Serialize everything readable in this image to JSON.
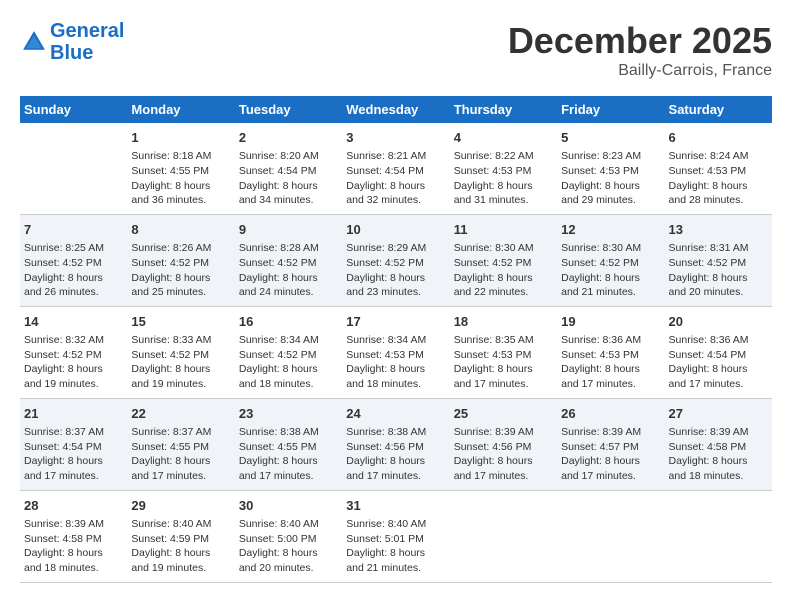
{
  "header": {
    "logo_line1": "General",
    "logo_line2": "Blue",
    "month": "December 2025",
    "location": "Bailly-Carrois, France"
  },
  "weekdays": [
    "Sunday",
    "Monday",
    "Tuesday",
    "Wednesday",
    "Thursday",
    "Friday",
    "Saturday"
  ],
  "weeks": [
    [
      {
        "day": "",
        "info": ""
      },
      {
        "day": "1",
        "info": "Sunrise: 8:18 AM\nSunset: 4:55 PM\nDaylight: 8 hours\nand 36 minutes."
      },
      {
        "day": "2",
        "info": "Sunrise: 8:20 AM\nSunset: 4:54 PM\nDaylight: 8 hours\nand 34 minutes."
      },
      {
        "day": "3",
        "info": "Sunrise: 8:21 AM\nSunset: 4:54 PM\nDaylight: 8 hours\nand 32 minutes."
      },
      {
        "day": "4",
        "info": "Sunrise: 8:22 AM\nSunset: 4:53 PM\nDaylight: 8 hours\nand 31 minutes."
      },
      {
        "day": "5",
        "info": "Sunrise: 8:23 AM\nSunset: 4:53 PM\nDaylight: 8 hours\nand 29 minutes."
      },
      {
        "day": "6",
        "info": "Sunrise: 8:24 AM\nSunset: 4:53 PM\nDaylight: 8 hours\nand 28 minutes."
      }
    ],
    [
      {
        "day": "7",
        "info": "Sunrise: 8:25 AM\nSunset: 4:52 PM\nDaylight: 8 hours\nand 26 minutes."
      },
      {
        "day": "8",
        "info": "Sunrise: 8:26 AM\nSunset: 4:52 PM\nDaylight: 8 hours\nand 25 minutes."
      },
      {
        "day": "9",
        "info": "Sunrise: 8:28 AM\nSunset: 4:52 PM\nDaylight: 8 hours\nand 24 minutes."
      },
      {
        "day": "10",
        "info": "Sunrise: 8:29 AM\nSunset: 4:52 PM\nDaylight: 8 hours\nand 23 minutes."
      },
      {
        "day": "11",
        "info": "Sunrise: 8:30 AM\nSunset: 4:52 PM\nDaylight: 8 hours\nand 22 minutes."
      },
      {
        "day": "12",
        "info": "Sunrise: 8:30 AM\nSunset: 4:52 PM\nDaylight: 8 hours\nand 21 minutes."
      },
      {
        "day": "13",
        "info": "Sunrise: 8:31 AM\nSunset: 4:52 PM\nDaylight: 8 hours\nand 20 minutes."
      }
    ],
    [
      {
        "day": "14",
        "info": "Sunrise: 8:32 AM\nSunset: 4:52 PM\nDaylight: 8 hours\nand 19 minutes."
      },
      {
        "day": "15",
        "info": "Sunrise: 8:33 AM\nSunset: 4:52 PM\nDaylight: 8 hours\nand 19 minutes."
      },
      {
        "day": "16",
        "info": "Sunrise: 8:34 AM\nSunset: 4:52 PM\nDaylight: 8 hours\nand 18 minutes."
      },
      {
        "day": "17",
        "info": "Sunrise: 8:34 AM\nSunset: 4:53 PM\nDaylight: 8 hours\nand 18 minutes."
      },
      {
        "day": "18",
        "info": "Sunrise: 8:35 AM\nSunset: 4:53 PM\nDaylight: 8 hours\nand 17 minutes."
      },
      {
        "day": "19",
        "info": "Sunrise: 8:36 AM\nSunset: 4:53 PM\nDaylight: 8 hours\nand 17 minutes."
      },
      {
        "day": "20",
        "info": "Sunrise: 8:36 AM\nSunset: 4:54 PM\nDaylight: 8 hours\nand 17 minutes."
      }
    ],
    [
      {
        "day": "21",
        "info": "Sunrise: 8:37 AM\nSunset: 4:54 PM\nDaylight: 8 hours\nand 17 minutes."
      },
      {
        "day": "22",
        "info": "Sunrise: 8:37 AM\nSunset: 4:55 PM\nDaylight: 8 hours\nand 17 minutes."
      },
      {
        "day": "23",
        "info": "Sunrise: 8:38 AM\nSunset: 4:55 PM\nDaylight: 8 hours\nand 17 minutes."
      },
      {
        "day": "24",
        "info": "Sunrise: 8:38 AM\nSunset: 4:56 PM\nDaylight: 8 hours\nand 17 minutes."
      },
      {
        "day": "25",
        "info": "Sunrise: 8:39 AM\nSunset: 4:56 PM\nDaylight: 8 hours\nand 17 minutes."
      },
      {
        "day": "26",
        "info": "Sunrise: 8:39 AM\nSunset: 4:57 PM\nDaylight: 8 hours\nand 17 minutes."
      },
      {
        "day": "27",
        "info": "Sunrise: 8:39 AM\nSunset: 4:58 PM\nDaylight: 8 hours\nand 18 minutes."
      }
    ],
    [
      {
        "day": "28",
        "info": "Sunrise: 8:39 AM\nSunset: 4:58 PM\nDaylight: 8 hours\nand 18 minutes."
      },
      {
        "day": "29",
        "info": "Sunrise: 8:40 AM\nSunset: 4:59 PM\nDaylight: 8 hours\nand 19 minutes."
      },
      {
        "day": "30",
        "info": "Sunrise: 8:40 AM\nSunset: 5:00 PM\nDaylight: 8 hours\nand 20 minutes."
      },
      {
        "day": "31",
        "info": "Sunrise: 8:40 AM\nSunset: 5:01 PM\nDaylight: 8 hours\nand 21 minutes."
      },
      {
        "day": "",
        "info": ""
      },
      {
        "day": "",
        "info": ""
      },
      {
        "day": "",
        "info": ""
      }
    ]
  ]
}
